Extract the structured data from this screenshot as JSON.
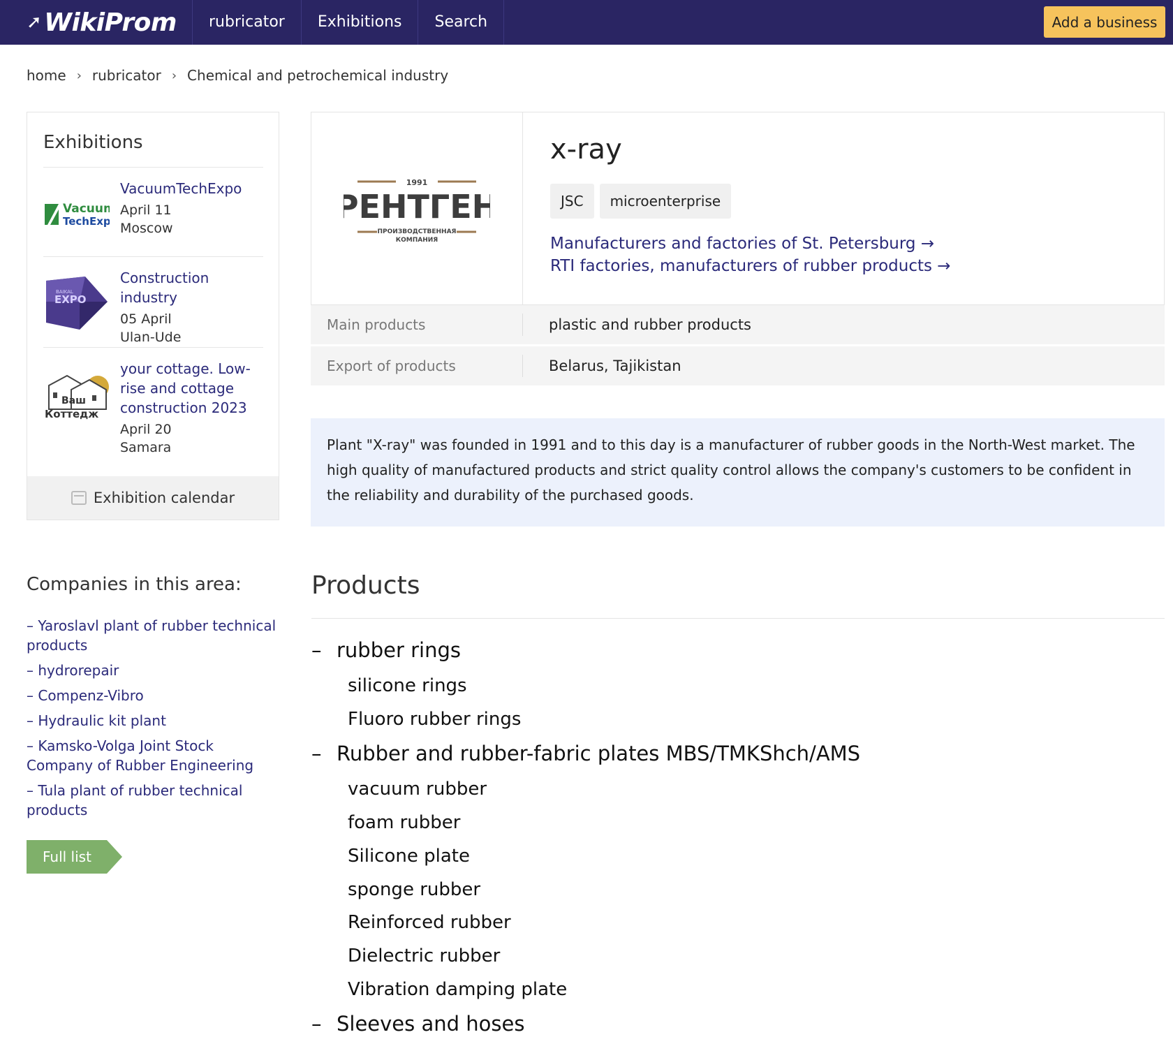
{
  "header": {
    "logo": "WikiProm",
    "nav": [
      "rubricator",
      "Exhibitions",
      "Search"
    ],
    "add_business": "Add a business"
  },
  "breadcrumb": [
    "home",
    "rubricator",
    "Chemical and petrochemical industry"
  ],
  "exhibitions": {
    "title": "Exhibitions",
    "items": [
      {
        "name": "VacuumTechExpo",
        "date": "April 11",
        "city": "Moscow",
        "logo_text_1": "Vacuum",
        "logo_text_2": "TechExpo"
      },
      {
        "name": "Construction industry",
        "date": "05 April",
        "city": "Ulan-Ude",
        "logo_text_1": "BAIKAL",
        "logo_text_2": "EXPO"
      },
      {
        "name": "your cottage. Low-rise and cottage construction 2023",
        "date": "April 20",
        "city": "Samara",
        "logo_text_1": "Ваш",
        "logo_text_2": "Коттедж"
      }
    ],
    "calendar_label": "Exhibition calendar"
  },
  "companies": {
    "title": "Companies in this area:",
    "items": [
      "– Yaroslavl plant of rubber technical products",
      "– hydrorepair",
      "– Compenz-Vibro",
      "– Hydraulic kit plant",
      "– Kamsko-Volga Joint Stock Company of Rubber Engineering",
      "– Tula plant of rubber technical products"
    ],
    "full_list": "Full list"
  },
  "company": {
    "name": "x-ray",
    "logo_year": "1991",
    "logo_main": "РЕНТГЕН",
    "logo_sub_1": "ПРОИЗВОДСТВЕННАЯ",
    "logo_sub_2": "КОМПАНИЯ",
    "tags": [
      "JSC",
      "microenterprise"
    ],
    "links": [
      "Manufacturers and factories of St. Petersburg →",
      "RTI factories, manufacturers of rubber products →"
    ],
    "info": [
      {
        "label": "Main products",
        "value": "plastic and rubber products"
      },
      {
        "label": "Export of products",
        "value": "Belarus, Tajikistan"
      }
    ],
    "description": "Plant \"X-ray\" was founded in 1991 and to this day is a manufacturer of rubber goods in the North-West market. The high quality of manufactured products and strict quality control allows the company's customers to be confident in the reliability and durability of the purchased goods."
  },
  "products": {
    "title": "Products",
    "groups": [
      {
        "name": "rubber rings",
        "items": [
          "silicone rings",
          "Fluoro rubber rings"
        ]
      },
      {
        "name": "Rubber and rubber-fabric plates MBS/TMKShch/AMS",
        "items": [
          "vacuum rubber",
          "foam rubber",
          "Silicone plate",
          "sponge rubber",
          "Reinforced rubber",
          "Dielectric rubber",
          "Vibration damping plate"
        ]
      },
      {
        "name": "Sleeves and hoses",
        "items": []
      }
    ]
  },
  "colors": {
    "header_bg": "#2a2563",
    "accent_button": "#f6c35c",
    "link": "#2b2a7a",
    "full_list_bg": "#7fb06a",
    "description_bg": "#ecf1fc"
  }
}
